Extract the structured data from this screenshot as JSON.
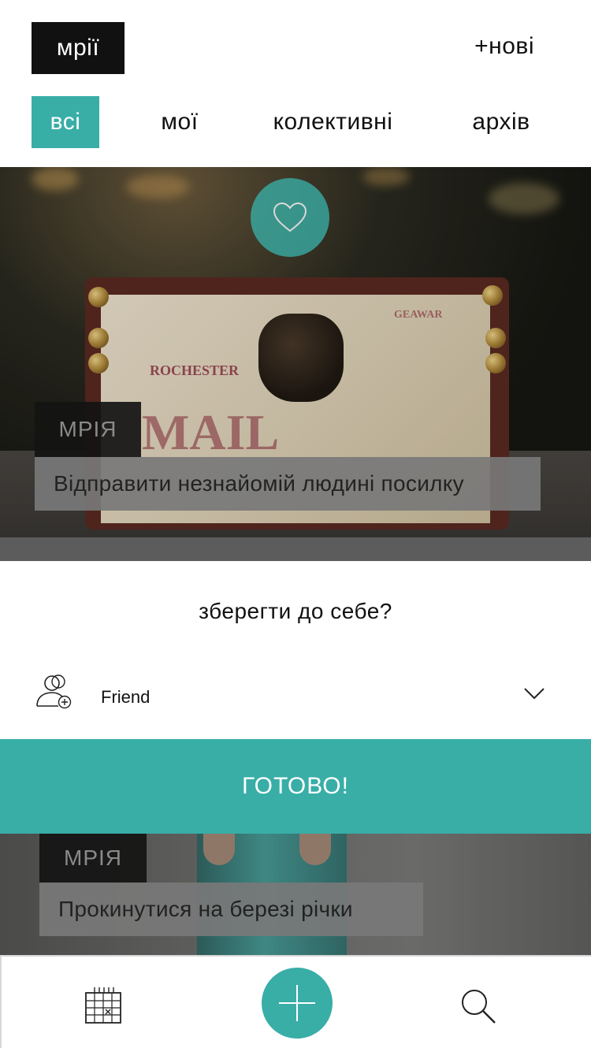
{
  "header": {
    "logo": "мрії",
    "new_button": "+нові"
  },
  "tabs": [
    {
      "label": "всі",
      "active": true
    },
    {
      "label": "мої",
      "active": false
    },
    {
      "label": "колективні",
      "active": false
    },
    {
      "label": "архів",
      "active": false
    }
  ],
  "cards": [
    {
      "tag": "МРІЯ",
      "title": "Відправити незнайомій людині посилку",
      "liked": false
    },
    {
      "tag": "МРІЯ",
      "title": "Прокинутися на березі річки"
    }
  ],
  "modal": {
    "title": "зберегти до себе?",
    "select_value": "Friend",
    "done_button": "ГОТОВО!"
  },
  "colors": {
    "accent": "#38aea7",
    "logo_bg": "#111111"
  },
  "icons": {
    "like": "heart-icon",
    "person": "add-person-icon",
    "dropdown": "chevron-down-icon",
    "calendar": "calendar-icon",
    "add": "plus-icon",
    "search": "search-icon"
  }
}
